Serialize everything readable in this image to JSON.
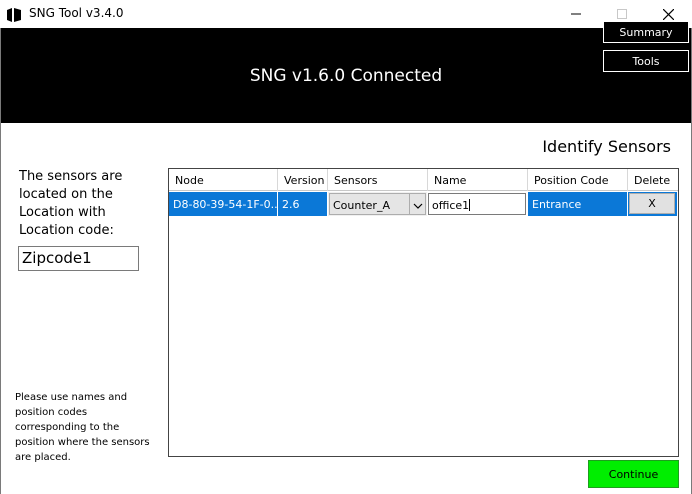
{
  "window": {
    "title": "SNG Tool v3.4.0"
  },
  "header": {
    "status": "SNG v1.6.0 Connected",
    "summary_label": "Summary",
    "tools_label": "Tools"
  },
  "section_title": "Identify Sensors",
  "location": {
    "description": "The sensors are located on the Location with Location code:",
    "code_value": "Zipcode1"
  },
  "hint": "Please use names and position codes corresponding to the position where the sensors are placed.",
  "table": {
    "columns": [
      "Node",
      "Version",
      "Sensors",
      "Name",
      "Position Code",
      "Delete"
    ],
    "rows": [
      {
        "node": "D8-80-39-54-1F-0...",
        "version": "2.6",
        "sensors": "Counter_A",
        "name": "office1",
        "position_code": "Entrance",
        "delete_label": "X"
      }
    ]
  },
  "continue_label": "Continue",
  "colors": {
    "header_bg": "#000000",
    "selection": "#0b78d7",
    "continue_bg": "#00ee00"
  }
}
